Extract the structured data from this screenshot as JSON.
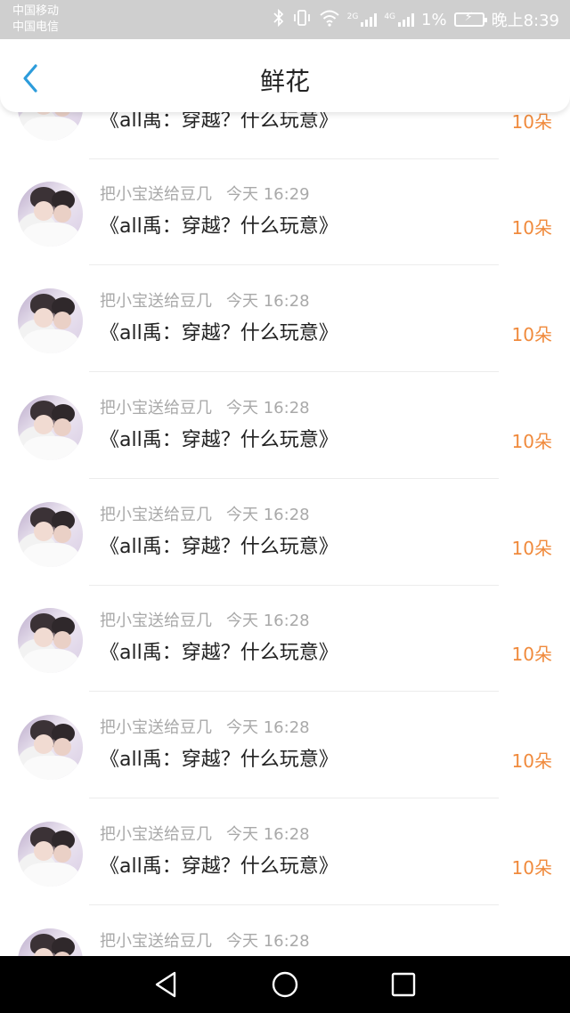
{
  "status_bar": {
    "carrier_1": "中国移动",
    "carrier_2": "中国电信",
    "battery": "1%",
    "time": "晚上8:39",
    "network_tag_1": "2G",
    "network_tag_2": "4G"
  },
  "header": {
    "title": "鲜花",
    "back_icon": "chevron-left-icon",
    "accent_color": "#2d9cdb"
  },
  "rows": [
    {
      "user": "",
      "time": "",
      "title": "《all禹：穿越？什么玩意》",
      "count": "10朵"
    },
    {
      "user": "把小宝送给豆几",
      "time": "今天 16:29",
      "title": "《all禹：穿越？什么玩意》",
      "count": "10朵"
    },
    {
      "user": "把小宝送给豆几",
      "time": "今天 16:28",
      "title": "《all禹：穿越？什么玩意》",
      "count": "10朵"
    },
    {
      "user": "把小宝送给豆几",
      "time": "今天 16:28",
      "title": "《all禹：穿越？什么玩意》",
      "count": "10朵"
    },
    {
      "user": "把小宝送给豆几",
      "time": "今天 16:28",
      "title": "《all禹：穿越？什么玩意》",
      "count": "10朵"
    },
    {
      "user": "把小宝送给豆几",
      "time": "今天 16:28",
      "title": "《all禹：穿越？什么玩意》",
      "count": "10朵"
    },
    {
      "user": "把小宝送给豆几",
      "time": "今天 16:28",
      "title": "《all禹：穿越？什么玩意》",
      "count": "10朵"
    },
    {
      "user": "把小宝送给豆几",
      "time": "今天 16:28",
      "title": "《all禹：穿越？什么玩意》",
      "count": "10朵"
    },
    {
      "user": "把小宝送给豆几",
      "time": "今天 16:28",
      "title": "",
      "count": ""
    }
  ],
  "colors": {
    "count": "#f08a3c",
    "meta": "#a9a9a9",
    "title": "#222222"
  },
  "navbar": {
    "icons": [
      "back-triangle-icon",
      "home-circle-icon",
      "recents-square-icon"
    ]
  }
}
